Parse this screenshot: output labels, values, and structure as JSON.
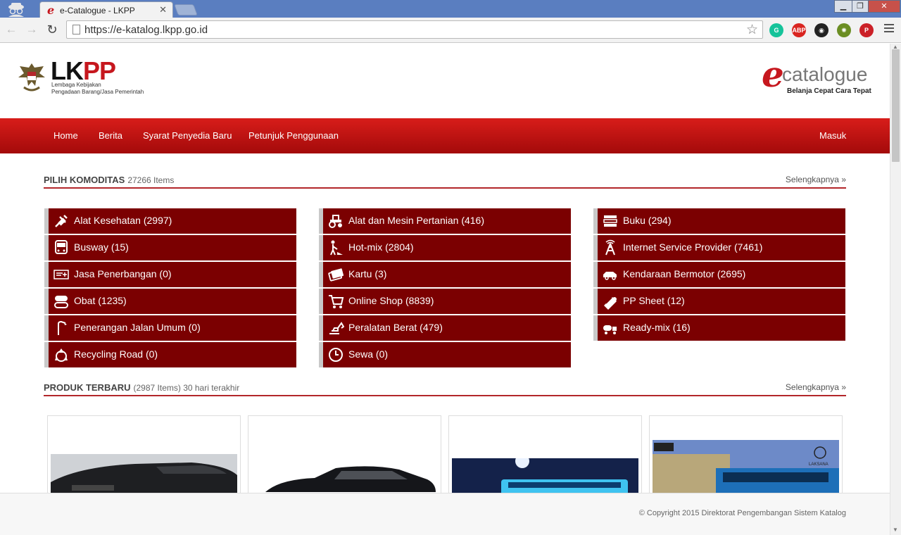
{
  "browser": {
    "tab_title": "e-Catalogue - LKPP",
    "tab_favicon": "e",
    "tab_close": "✕",
    "url": "https://e-katalog.lkpp.go.id",
    "extensions": [
      {
        "name": "grammarly-icon",
        "label": "G",
        "color": "#15c39a"
      },
      {
        "name": "adblock-plus-icon",
        "label": "ABP",
        "color": "#d9241f"
      },
      {
        "name": "owl-icon",
        "label": "◉",
        "color": "#222222"
      },
      {
        "name": "bug-extension-icon",
        "label": "✺",
        "color": "#6b8e23"
      },
      {
        "name": "pinterest-icon",
        "label": "P",
        "color": "#cb2027"
      }
    ]
  },
  "header": {
    "logo_main_a": "LK",
    "logo_main_b": "PP",
    "logo_sub_1": "Lembaga Kebijakan",
    "logo_sub_2": "Pengadaan Barang/Jasa Pemerintah",
    "ecat_e": "e",
    "ecat_word": "catalogue",
    "ecat_tagline": "Belanja Cepat Cara Tepat"
  },
  "nav": {
    "home": "Home",
    "news": "Berita",
    "terms": "Syarat Penyedia Baru",
    "guide": "Petunjuk Penggunaan",
    "login": "Masuk"
  },
  "komoditas": {
    "title": "PILIH KOMODITAS",
    "count": "27266 Items",
    "more": "Selengkapnya »",
    "columns": [
      [
        {
          "label": "Alat Kesehatan (2997)",
          "icon": "syringe-icon"
        },
        {
          "label": "Busway (15)",
          "icon": "bus-icon"
        },
        {
          "label": "Jasa Penerbangan (0)",
          "icon": "airplane-ticket-icon"
        },
        {
          "label": "Obat (1235)",
          "icon": "pills-icon"
        },
        {
          "label": "Penerangan Jalan Umum (0)",
          "icon": "street-lamp-icon"
        },
        {
          "label": "Recycling Road (0)",
          "icon": "recycle-icon"
        }
      ],
      [
        {
          "label": "Alat dan Mesin Pertanian (416)",
          "icon": "tractor-icon"
        },
        {
          "label": "Hot-mix (2804)",
          "icon": "road-worker-icon"
        },
        {
          "label": "Kartu (3)",
          "icon": "cards-icon"
        },
        {
          "label": "Online Shop (8839)",
          "icon": "shopping-cart-icon"
        },
        {
          "label": "Peralatan Berat (479)",
          "icon": "excavator-icon"
        },
        {
          "label": "Sewa (0)",
          "icon": "clock-icon"
        }
      ],
      [
        {
          "label": "Buku (294)",
          "icon": "books-icon"
        },
        {
          "label": "Internet Service Provider (7461)",
          "icon": "antenna-tower-icon"
        },
        {
          "label": "Kendaraan Bermotor (2695)",
          "icon": "car-icon"
        },
        {
          "label": "PP Sheet (12)",
          "icon": "sheet-roll-icon"
        },
        {
          "label": "Ready-mix (16)",
          "icon": "mixer-truck-icon"
        }
      ]
    ]
  },
  "produk": {
    "title": "PRODUK TERBARU",
    "count": "(2987 Items) 30 hari terakhir",
    "more": "Selengkapnya »",
    "cards": [
      {
        "name": "product-card-black-suv"
      },
      {
        "name": "product-card-black-sedan"
      },
      {
        "name": "product-card-blue-bus-night"
      },
      {
        "name": "product-card-laksana-bus",
        "badge": "LAKSANA"
      }
    ]
  },
  "footer": {
    "copyright": "© Copyright 2015 Direktorat Pengembangan Sistem Katalog"
  }
}
